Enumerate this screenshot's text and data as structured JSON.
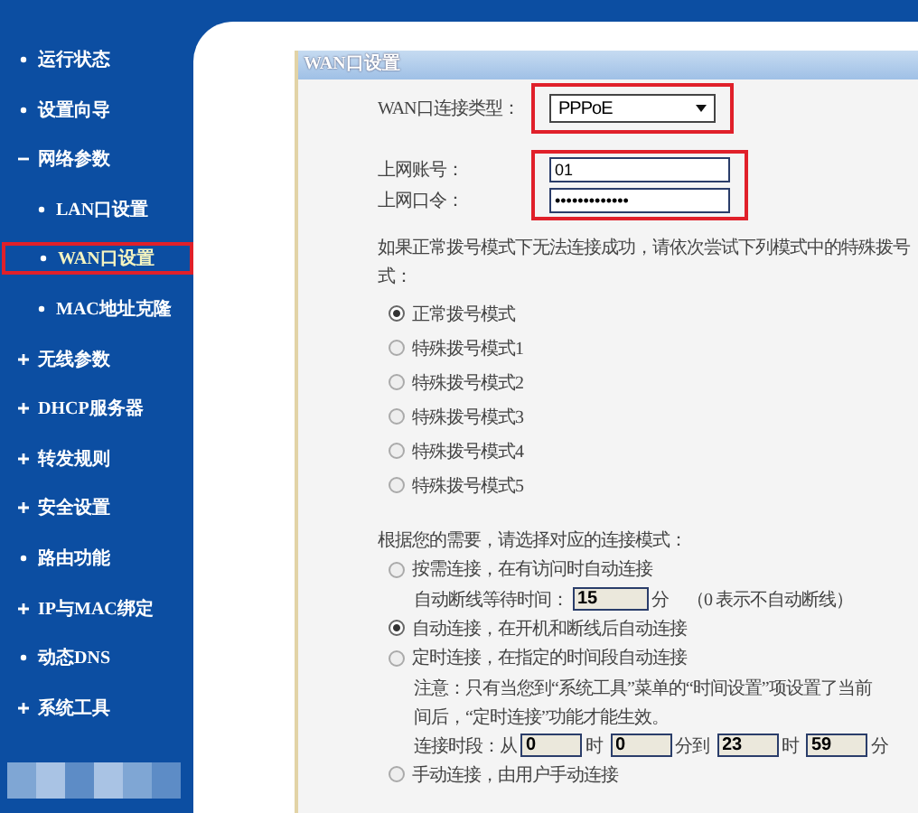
{
  "sidebar": {
    "items": [
      {
        "label": "运行状态",
        "selected": false
      },
      {
        "label": "设置向导",
        "selected": false
      },
      {
        "label": "网络参数",
        "selected": false,
        "expanded": true,
        "children": [
          {
            "label": "LAN口设置",
            "selected": false
          },
          {
            "label": "WAN口设置",
            "selected": true
          },
          {
            "label": "MAC地址克隆",
            "selected": false
          }
        ]
      },
      {
        "label": "无线参数",
        "selected": false,
        "expanded": false
      },
      {
        "label": "DHCP服务器",
        "selected": false,
        "expanded": false
      },
      {
        "label": "转发规则",
        "selected": false,
        "expanded": false
      },
      {
        "label": "安全设置",
        "selected": false,
        "expanded": false
      },
      {
        "label": "路由功能",
        "selected": false
      },
      {
        "label": "IP与MAC绑定",
        "selected": false,
        "expanded": false
      },
      {
        "label": "动态DNS",
        "selected": false
      },
      {
        "label": "系统工具",
        "selected": false,
        "expanded": false
      }
    ]
  },
  "panel": {
    "title": "WAN口设置",
    "connection_type": {
      "label": "WAN口连接类型：",
      "value": "PPPoE"
    },
    "account": {
      "label": "上网账号：",
      "value": "01"
    },
    "password": {
      "label": "上网口令：",
      "value": "•••••••••••••"
    },
    "dial_hint_lines": [
      "如果正常拨号模式下无法连接成功，请依次尝试下列模式中的特殊拨号",
      "式："
    ],
    "dial_modes": [
      {
        "label": "正常拨号模式",
        "selected": true
      },
      {
        "label": "特殊拨号模式1",
        "selected": false
      },
      {
        "label": "特殊拨号模式2",
        "selected": false
      },
      {
        "label": "特殊拨号模式3",
        "selected": false
      },
      {
        "label": "特殊拨号模式4",
        "selected": false
      },
      {
        "label": "特殊拨号模式5",
        "selected": false
      }
    ],
    "mode_prompt": "根据您的需要，请选择对应的连接模式：",
    "connection_modes": [
      {
        "label": "按需连接，在有访问时自动连接",
        "selected": false,
        "idle": {
          "label": "自动断线等待时间：",
          "value": "15",
          "unit": "分",
          "hint": "（0 表示不自动断线）"
        }
      },
      {
        "label": "自动连接，在开机和断线后自动连接",
        "selected": true
      },
      {
        "label": "定时连接，在指定的时间段自动连接",
        "selected": false,
        "note_lines": [
          "注意：只有当您到“系统工具”菜单的“时间设置”项设置了当前",
          "间后，“定时连接”功能才能生效。"
        ],
        "schedule": {
          "label": "连接时段：从",
          "fields": [
            {
              "value": "0",
              "unit": "时"
            },
            {
              "value": "0",
              "unit": "分到"
            },
            {
              "value": "23",
              "unit": "时"
            },
            {
              "value": "59",
              "unit": "分"
            }
          ]
        }
      },
      {
        "label": "手动连接，由用户手动连接",
        "selected": false
      }
    ]
  }
}
